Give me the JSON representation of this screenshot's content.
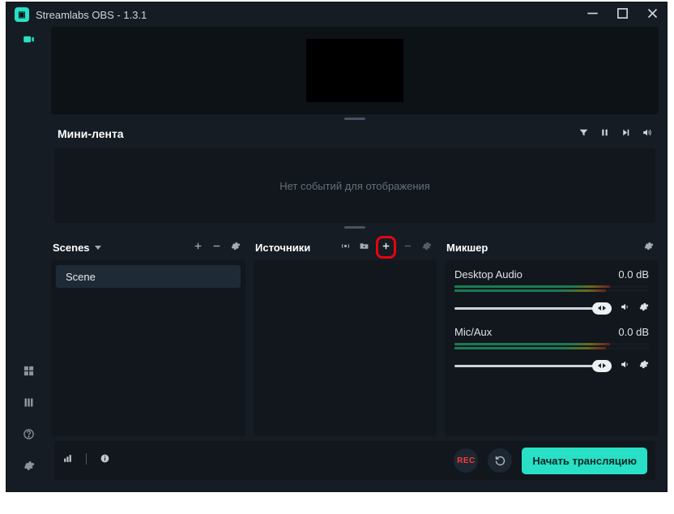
{
  "title": "Streamlabs OBS - 1.3.1",
  "minifeed": {
    "heading": "Мини-лента",
    "empty": "Нет событий для отображения"
  },
  "panels": {
    "scenes": {
      "heading": "Scenes",
      "items": [
        "Scene"
      ]
    },
    "sources": {
      "heading": "Источники"
    },
    "mixer": {
      "heading": "Микшер",
      "items": [
        {
          "name": "Desktop Audio",
          "level": "0.0 dB"
        },
        {
          "name": "Mic/Aux",
          "level": "0.0 dB"
        }
      ]
    }
  },
  "bottombar": {
    "rec": "REC",
    "go_live": "Начать трансляцию"
  }
}
